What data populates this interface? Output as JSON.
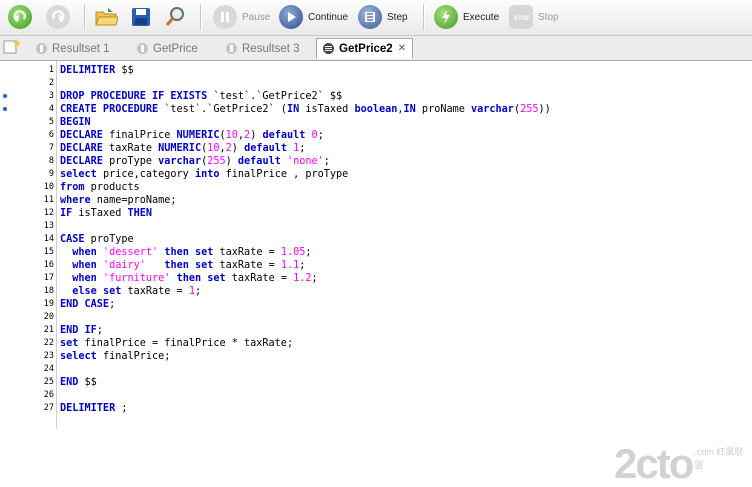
{
  "toolbar": {
    "pause_label": "Pause",
    "continue_label": "Continue",
    "step_label": "Step",
    "execute_label": "Execute",
    "stop_label": "Stop"
  },
  "tabs": [
    {
      "label": "Resultset 1",
      "active": false
    },
    {
      "label": "GetPrice",
      "active": false
    },
    {
      "label": "Resultset 3",
      "active": false
    },
    {
      "label": "GetPrice2",
      "active": true
    }
  ],
  "editor": {
    "lines": [
      {
        "n": "1",
        "tokens": [
          [
            "kw",
            "DELIMITER"
          ],
          [
            "t",
            " $$"
          ]
        ]
      },
      {
        "n": "2",
        "tokens": []
      },
      {
        "n": "3",
        "bp": true,
        "tokens": [
          [
            "kw",
            "DROP PROCEDURE IF EXISTS"
          ],
          [
            "t",
            " `test`.`GetPrice2` $$"
          ]
        ]
      },
      {
        "n": "4",
        "bp": true,
        "tokens": [
          [
            "kw",
            "CREATE PROCEDURE"
          ],
          [
            "t",
            " `test`.`GetPrice2` ("
          ],
          [
            "kw",
            "IN"
          ],
          [
            "t",
            " isTaxed "
          ],
          [
            "kw",
            "boolean"
          ],
          [
            "t",
            ","
          ],
          [
            "kw",
            "IN"
          ],
          [
            "t",
            " proName "
          ],
          [
            "kw",
            "varchar"
          ],
          [
            "t",
            "("
          ],
          [
            "num",
            "255"
          ],
          [
            "t",
            "))"
          ]
        ]
      },
      {
        "n": "5",
        "tokens": [
          [
            "kw",
            "BEGIN"
          ]
        ]
      },
      {
        "n": "6",
        "tokens": [
          [
            "kw",
            "DECLARE"
          ],
          [
            "t",
            " finalPrice "
          ],
          [
            "kw",
            "NUMERIC"
          ],
          [
            "t",
            "("
          ],
          [
            "num",
            "10"
          ],
          [
            "t",
            ","
          ],
          [
            "num",
            "2"
          ],
          [
            "t",
            ") "
          ],
          [
            "kw",
            "default"
          ],
          [
            "t",
            " "
          ],
          [
            "num",
            "0"
          ],
          [
            "t",
            ";"
          ]
        ]
      },
      {
        "n": "7",
        "tokens": [
          [
            "kw",
            "DECLARE"
          ],
          [
            "t",
            " taxRate "
          ],
          [
            "kw",
            "NUMERIC"
          ],
          [
            "t",
            "("
          ],
          [
            "num",
            "10"
          ],
          [
            "t",
            ","
          ],
          [
            "num",
            "2"
          ],
          [
            "t",
            ") "
          ],
          [
            "kw",
            "default"
          ],
          [
            "t",
            " "
          ],
          [
            "num",
            "1"
          ],
          [
            "t",
            ";"
          ]
        ]
      },
      {
        "n": "8",
        "tokens": [
          [
            "kw",
            "DECLARE"
          ],
          [
            "t",
            " proType "
          ],
          [
            "kw",
            "varchar"
          ],
          [
            "t",
            "("
          ],
          [
            "num",
            "255"
          ],
          [
            "t",
            ") "
          ],
          [
            "kw",
            "default"
          ],
          [
            "t",
            " "
          ],
          [
            "str",
            "'none'"
          ],
          [
            "t",
            ";"
          ]
        ]
      },
      {
        "n": "9",
        "tokens": [
          [
            "kw",
            "select"
          ],
          [
            "t",
            " price,category "
          ],
          [
            "kw",
            "into"
          ],
          [
            "t",
            " finalPrice , proType"
          ]
        ]
      },
      {
        "n": "10",
        "tokens": [
          [
            "kw",
            "from"
          ],
          [
            "t",
            " products"
          ]
        ]
      },
      {
        "n": "11",
        "tokens": [
          [
            "kw",
            "where"
          ],
          [
            "t",
            " name=proName;"
          ]
        ]
      },
      {
        "n": "12",
        "tokens": [
          [
            "kw",
            "IF"
          ],
          [
            "t",
            " isTaxed "
          ],
          [
            "kw",
            "THEN"
          ]
        ]
      },
      {
        "n": "13",
        "tokens": []
      },
      {
        "n": "14",
        "tokens": [
          [
            "kw",
            "CASE"
          ],
          [
            "t",
            " proType"
          ]
        ]
      },
      {
        "n": "15",
        "tokens": [
          [
            "t",
            "  "
          ],
          [
            "kw",
            "when"
          ],
          [
            "t",
            " "
          ],
          [
            "str",
            "'dessert'"
          ],
          [
            "t",
            " "
          ],
          [
            "kw",
            "then set"
          ],
          [
            "t",
            " taxRate = "
          ],
          [
            "num",
            "1.05"
          ],
          [
            "t",
            ";"
          ]
        ]
      },
      {
        "n": "16",
        "tokens": [
          [
            "t",
            "  "
          ],
          [
            "kw",
            "when"
          ],
          [
            "t",
            " "
          ],
          [
            "str",
            "'dairy'"
          ],
          [
            "t",
            "   "
          ],
          [
            "kw",
            "then set"
          ],
          [
            "t",
            " taxRate = "
          ],
          [
            "num",
            "1.1"
          ],
          [
            "t",
            ";"
          ]
        ]
      },
      {
        "n": "17",
        "tokens": [
          [
            "t",
            "  "
          ],
          [
            "kw",
            "when"
          ],
          [
            "t",
            " "
          ],
          [
            "str",
            "'furniture'"
          ],
          [
            "t",
            " "
          ],
          [
            "kw",
            "then set"
          ],
          [
            "t",
            " taxRate = "
          ],
          [
            "num",
            "1.2"
          ],
          [
            "t",
            ";"
          ]
        ]
      },
      {
        "n": "18",
        "tokens": [
          [
            "t",
            "  "
          ],
          [
            "kw",
            "else set"
          ],
          [
            "t",
            " taxRate = "
          ],
          [
            "num",
            "1"
          ],
          [
            "t",
            ";"
          ]
        ]
      },
      {
        "n": "19",
        "tokens": [
          [
            "kw",
            "END CASE"
          ],
          [
            "t",
            ";"
          ]
        ]
      },
      {
        "n": "20",
        "tokens": []
      },
      {
        "n": "21",
        "tokens": [
          [
            "kw",
            "END IF"
          ],
          [
            "t",
            ";"
          ]
        ]
      },
      {
        "n": "22",
        "tokens": [
          [
            "kw",
            "set"
          ],
          [
            "t",
            " finalPrice = finalPrice * taxRate;"
          ]
        ]
      },
      {
        "n": "23",
        "tokens": [
          [
            "kw",
            "select"
          ],
          [
            "t",
            " finalPrice;"
          ]
        ]
      },
      {
        "n": "24",
        "tokens": []
      },
      {
        "n": "25",
        "tokens": [
          [
            "kw",
            "END"
          ],
          [
            "t",
            " $$"
          ]
        ]
      },
      {
        "n": "26",
        "tokens": []
      },
      {
        "n": "27",
        "tokens": [
          [
            "kw",
            "DELIMITER"
          ],
          [
            "t",
            " ;"
          ]
        ]
      }
    ]
  },
  "watermark": {
    "big": "2cto",
    "small": ".com 红黑联盟"
  }
}
